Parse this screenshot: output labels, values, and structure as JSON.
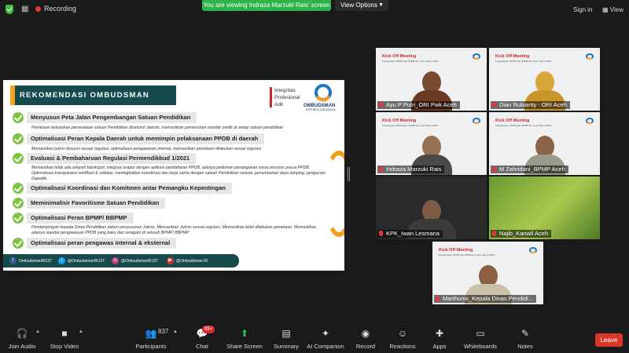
{
  "topbar": {
    "recording_label": "Recording",
    "viewing_banner": "You are viewing Indraza Marzuki Rais' screen",
    "view_options_label": "View Options",
    "sign_in_label": "Sign in",
    "view_label": "View"
  },
  "slide": {
    "heading": "REKOMENDASI OMBUDSMAN",
    "values_line1": "Integritas",
    "values_line2": "Profesional",
    "values_line3": "Adil",
    "org_name": "OMBUDSMAN",
    "org_sub": "REPUBLIK INDONESIA",
    "recommendations": [
      {
        "title": "Menyusun Peta Jalan Pengembangan Satuan Pendidikan",
        "desc": "Pemetaan kebutuhan pemerataan satuan Pendidikan diseluruh daerah, memastikan pemenuhan standar yanlik di setiap satuan pendidikan"
      },
      {
        "title": "Optimalisasi Peran Kepala Daerah untuk memimpin pelaksanaan PPDB di daerah",
        "desc": "Memastikan juknis disusun sesuai regulasi, optimalisasi pengawasan internal, memastikan pemetaan dilakukan sesuai regulasi"
      },
      {
        "title": "Evaluasi & Pembaharuan Regulasi Permendikbud 1/2021",
        "desc": "Memastikan tidak ada wilayah blankspot, integrasi erapor dengan aplikasi pendaftaran PPDB, adanya pedoman penanganan siswa tercecer pasca PPDB, Optimalisasi transparansi verifikasi & validasi, meningkatkan koordinasi dan kerja sama dengan satuan Pendidikan swasta, penambahan daya tamping, pengucian Dapodik."
      },
      {
        "title": "Optimalisasi Koordinasi dan Komitmen antar Pemangku Kepentingan",
        "desc": ""
      },
      {
        "title": "Meminimalisir Favoritisme Satuan Pendidikan",
        "desc": ""
      },
      {
        "title": "Optimalisasi Peran BPMP/ BBPMP",
        "desc": "Pendampingan kepada Dinas Pendidikan dalam penyusunan Juknis, Memastikan Juknis sesuai regulasi, Memastikan telah dilakukan pemetaan, Memastikan adanya standar pengawasan PPDB yang baku dan seragam di seluruh BPMP/ BBPMP"
      },
      {
        "title": "Optimalisasi peran pengawas internal & eksternal",
        "desc": ""
      }
    ],
    "social": {
      "facebook": "OmbudsmanRI137",
      "twitter": "@OmbudsmanRI137",
      "instagram": "@OmbudsmanRI137",
      "youtube": "@Ombudsman RI"
    }
  },
  "tiles": {
    "kick_off_title": "Kick Off Meeting",
    "kick_off_sub": "Pengawasan PPDB dan SPMB Ser Aceh Tahun 2025",
    "participants": [
      {
        "name": "Ayu P Putri_ORI Pwk Aceh"
      },
      {
        "name": "Dian Rubianty - ORI Aceh"
      },
      {
        "name": "Indraza Marzuki Rais"
      },
      {
        "name": "M Zahridani_BPMP Aceh"
      },
      {
        "name": "KPK_Iwan Lesmana"
      },
      {
        "name": "Najib_Kanwil Aceh"
      },
      {
        "name": "Marthunis_Kepala Dinas Pendidi..."
      }
    ]
  },
  "toolbar": {
    "join_audio": "Join Audio",
    "stop_video": "Stop Video",
    "participants": "Participants",
    "participant_count": "837",
    "chat": "Chat",
    "chat_badge": "99+",
    "share_screen": "Share Screen",
    "summary": "Summary",
    "ai_companion": "AI Companion",
    "record": "Record",
    "reactions": "Reactions",
    "apps": "Apps",
    "whiteboards": "Whiteboards",
    "notes": "Notes",
    "leave": "Leave"
  },
  "colors": {
    "accent_green": "#2db34a",
    "slide_teal": "#164a4d",
    "check_green": "#7ec440",
    "leave_red": "#d9362b",
    "active_border": "#8fc32e"
  },
  "icons": [
    "shield-check-icon",
    "grid-icon",
    "recording-dot-icon",
    "chevron-down-icon",
    "headphones-icon",
    "video-icon",
    "participants-icon",
    "chat-icon",
    "share-screen-icon",
    "summary-icon",
    "ai-companion-icon",
    "record-icon",
    "reactions-icon",
    "apps-icon",
    "whiteboards-icon",
    "notes-icon",
    "mic-muted-icon"
  ]
}
